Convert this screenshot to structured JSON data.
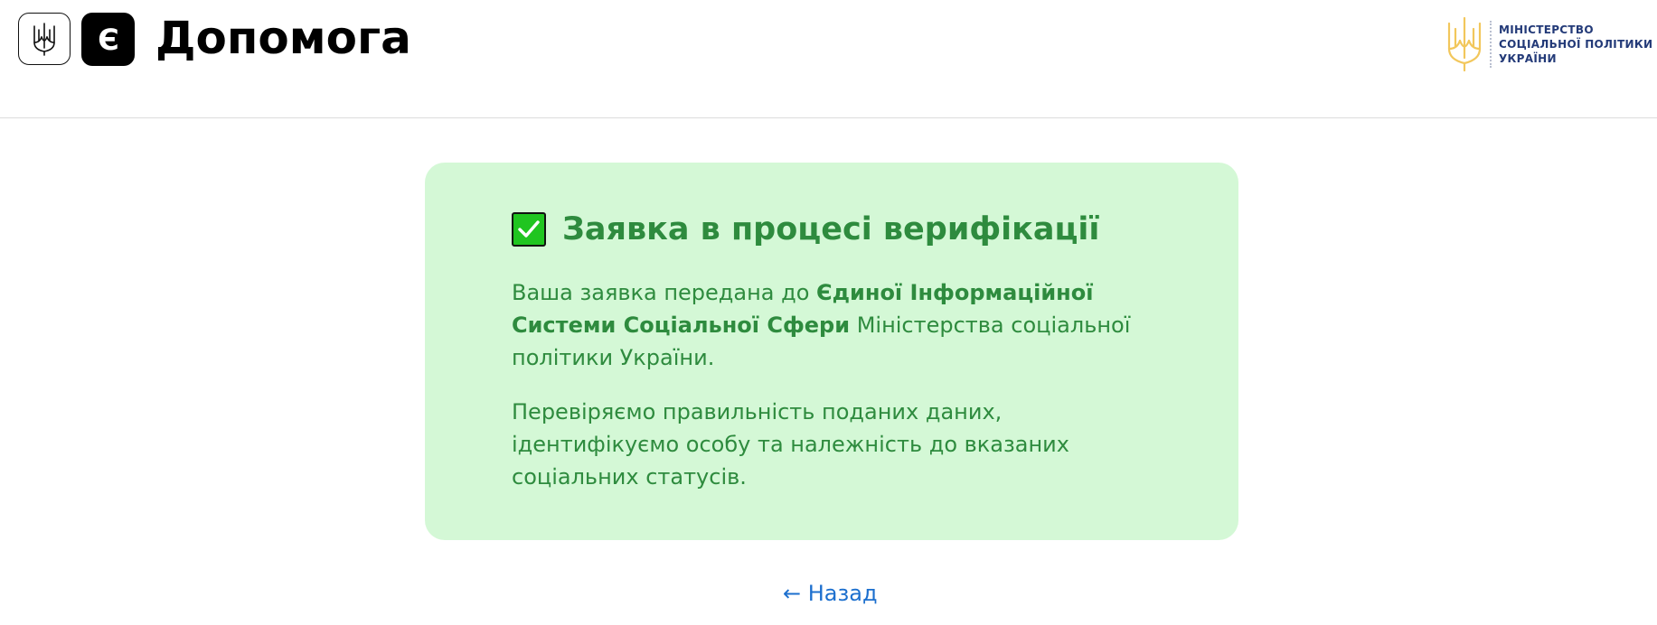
{
  "header": {
    "brand_letter": "Є",
    "brand_title": "Допомога",
    "ministry": {
      "line1": "МІНІСТЕРСТВО",
      "line2": "СОЦІАЛЬНОЇ ПОЛІТИКИ",
      "line3": "УКРАЇНИ"
    }
  },
  "status_card": {
    "title": "Заявка в процесі верифікації",
    "paragraph1": {
      "before": "Ваша заявка передана до ",
      "bold": "Єдиної Інформаційної Системи Соціальної Сфери",
      "after": " Міністерства соціальної політики України."
    },
    "paragraph2": "Перевіряємо правильність поданих даних, ідентифікуємо особу та належність до вказаних соціальних статусів."
  },
  "back_link": {
    "label": "← Назад"
  },
  "colors": {
    "card_background": "#d4f8d6",
    "card_text": "#2e8b3e",
    "check_green": "#20c520",
    "link": "#1c6fce",
    "ministry_text": "#233a78",
    "ministry_emblem": "#f2c75c"
  },
  "icons": {
    "gov_logo": "trident-icon",
    "brand": "e-letter-icon",
    "ministry_logo": "ministry-trident-icon",
    "status": "checkmark-icon"
  }
}
